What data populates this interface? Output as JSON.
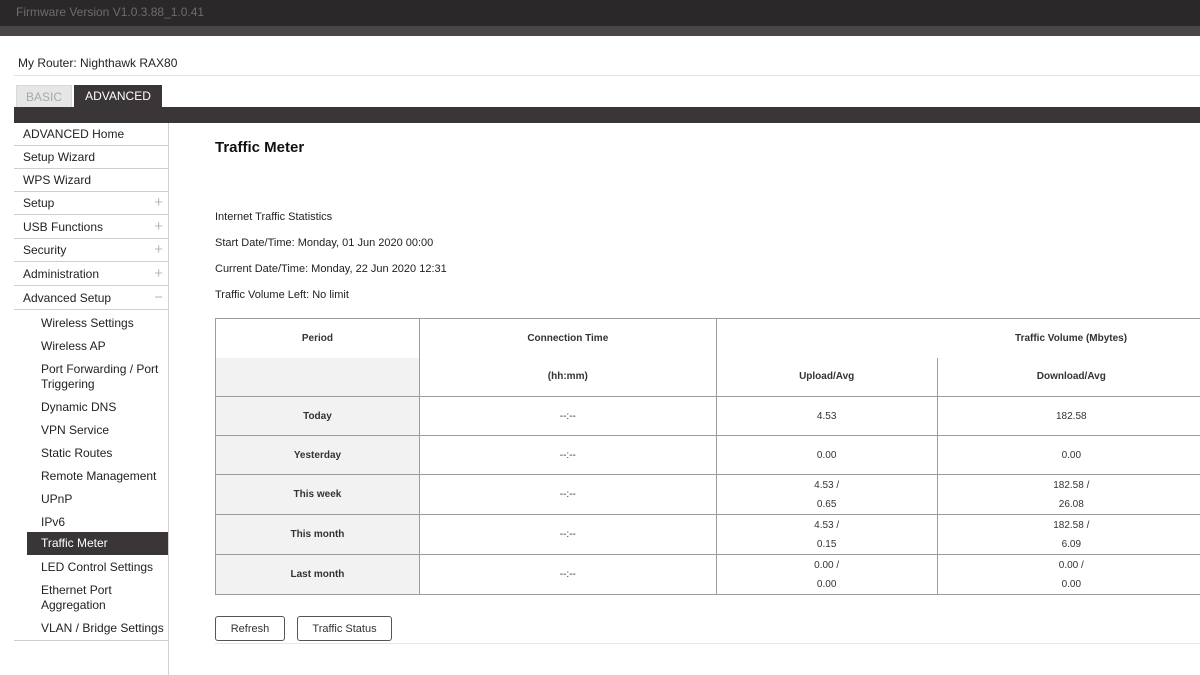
{
  "header": {
    "firmware": "Firmware Version V1.0.3.88_1.0.41",
    "router_label": "My Router: Nighthawk RAX80"
  },
  "tabs": [
    {
      "label": "BASIC",
      "active": false
    },
    {
      "label": "ADVANCED",
      "active": true
    }
  ],
  "sidebar": {
    "items": [
      {
        "label": "ADVANCED Home",
        "toggle": ""
      },
      {
        "label": "Setup Wizard",
        "toggle": ""
      },
      {
        "label": "WPS Wizard",
        "toggle": ""
      },
      {
        "label": "Setup",
        "toggle": "+"
      },
      {
        "label": "USB Functions",
        "toggle": "+"
      },
      {
        "label": "Security",
        "toggle": "+"
      },
      {
        "label": "Administration",
        "toggle": "+"
      },
      {
        "label": "Advanced Setup",
        "toggle": "−"
      }
    ],
    "sub_items": [
      {
        "label": "Wireless Settings"
      },
      {
        "label": "Wireless AP"
      },
      {
        "label": "Port Forwarding / Port Triggering"
      },
      {
        "label": "Dynamic DNS"
      },
      {
        "label": "VPN Service"
      },
      {
        "label": "Static Routes"
      },
      {
        "label": "Remote Management"
      },
      {
        "label": "UPnP"
      },
      {
        "label": "IPv6"
      },
      {
        "label": "Traffic Meter",
        "active": true
      },
      {
        "label": "LED Control Settings"
      },
      {
        "label": "Ethernet Port Aggregation"
      },
      {
        "label": "VLAN / Bridge Settings"
      }
    ]
  },
  "main": {
    "title": "Traffic Meter",
    "stats_heading": "Internet Traffic Statistics",
    "start": "Start Date/Time: Monday, 01 Jun 2020 00:00",
    "current": "Current Date/Time: Monday, 22 Jun 2020 12:31",
    "volume_left": "Traffic Volume Left: No limit"
  },
  "table": {
    "headers": {
      "period": "Period",
      "connection_time": "Connection Time",
      "traffic_volume": "Traffic Volume (Mbytes)",
      "hhmm": "(hh:mm)",
      "upload": "Upload/Avg",
      "download": "Download/Avg"
    },
    "rows": [
      {
        "period": "Today",
        "conn": "--:--",
        "upload": [
          "4.53"
        ],
        "download": [
          "182.58"
        ]
      },
      {
        "period": "Yesterday",
        "conn": "--:--",
        "upload": [
          "0.00"
        ],
        "download": [
          "0.00"
        ]
      },
      {
        "period": "This week",
        "conn": "--:--",
        "upload": [
          "4.53 /",
          "0.65"
        ],
        "download": [
          "182.58 /",
          "26.08"
        ]
      },
      {
        "period": "This month",
        "conn": "--:--",
        "upload": [
          "4.53 /",
          "0.15"
        ],
        "download": [
          "182.58 /",
          "6.09"
        ]
      },
      {
        "period": "Last month",
        "conn": "--:--",
        "upload": [
          "0.00 /",
          "0.00"
        ],
        "download": [
          "0.00 /",
          "0.00"
        ]
      }
    ]
  },
  "buttons": {
    "refresh": "Refresh",
    "traffic_status": "Traffic Status"
  }
}
